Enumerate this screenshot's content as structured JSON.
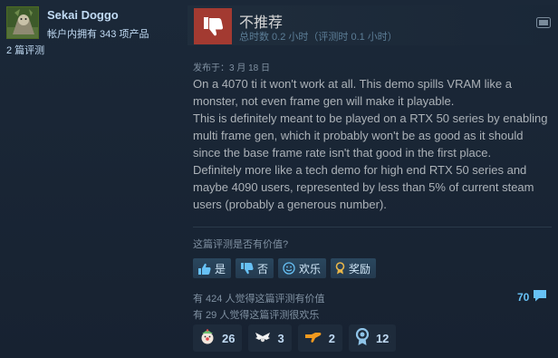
{
  "author": {
    "name": "Sekai Doggo",
    "owned": "帐户内拥有 343 项产品",
    "reviews": "2 篇评测"
  },
  "review": {
    "verdict": "不推荐",
    "hours": "总时数 0.2 小时（评测时 0.1 小时）",
    "posted": "发布于：3 月 18 日",
    "paragraphs": [
      "On a 4070 ti it won't work at all. This demo spills VRAM like a monster, not even frame gen will make it playable.",
      "This is definitely meant to be played on a RTX 50 series by enabling multi frame gen, which it probably won't be as good as it should since the base frame rate isn't that good in the first place.",
      "Definitely more like a tech demo for high end RTX 50 series and maybe 4090 users, represented by less than 5% of current steam users (probably a generous number)."
    ]
  },
  "helpful": {
    "question": "这篇评测是否有价值?",
    "yes": "是",
    "no": "否",
    "funny": "欢乐",
    "award": "奖励"
  },
  "stats": {
    "helpful": "有 424 人觉得这篇评测有价值",
    "funny": "有 29 人觉得这篇评测很欢乐",
    "comments": "70"
  },
  "awards": [
    {
      "icon": "clown-award-icon",
      "count": "26"
    },
    {
      "icon": "wings-award-icon",
      "count": "3"
    },
    {
      "icon": "handshake-award-icon",
      "count": "2"
    },
    {
      "icon": "medal-award-icon",
      "count": "12"
    }
  ],
  "colors": {
    "thumb_down_bg": "#a33a31",
    "link_blue": "#67c1f5",
    "background": "#1b2838"
  }
}
